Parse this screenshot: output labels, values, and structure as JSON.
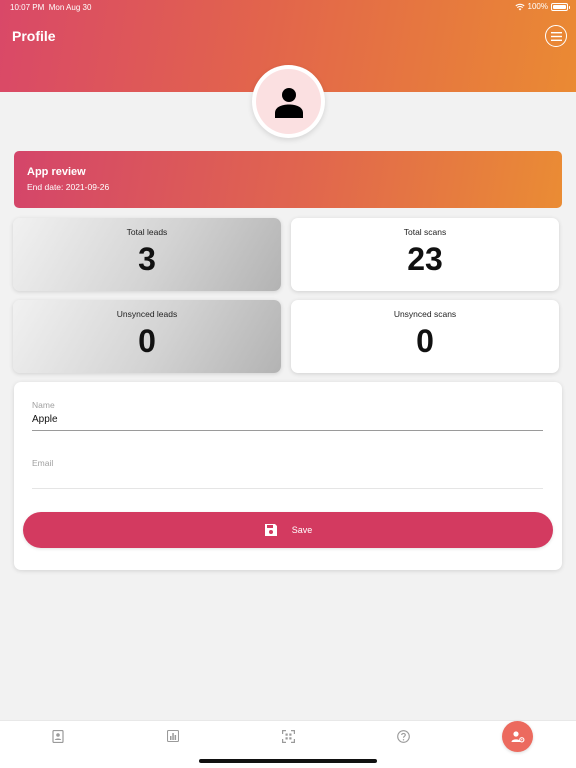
{
  "status_bar": {
    "time": "10:07 PM",
    "date": "Mon Aug 30",
    "battery": "100%"
  },
  "header": {
    "title": "Profile"
  },
  "banner": {
    "title": "App review",
    "end_date": "End date: 2021-09-26"
  },
  "stats": [
    {
      "label": "Total leads",
      "value": "3"
    },
    {
      "label": "Total scans",
      "value": "23"
    },
    {
      "label": "Unsynced leads",
      "value": "0"
    },
    {
      "label": "Unsynced scans",
      "value": "0"
    }
  ],
  "form": {
    "name_label": "Name",
    "name_value": "Apple",
    "email_label": "Email",
    "email_value": "",
    "save_label": "Save"
  },
  "tabs": [
    {
      "icon": "contacts-icon"
    },
    {
      "icon": "stats-icon"
    },
    {
      "icon": "scan-icon"
    },
    {
      "icon": "help-icon"
    },
    {
      "icon": "profile-settings-icon"
    }
  ],
  "colors": {
    "accent": "#d33a60",
    "gradient_start": "#d94868",
    "gradient_end": "#ea8a33",
    "active_tab": "#ec6a5e"
  }
}
